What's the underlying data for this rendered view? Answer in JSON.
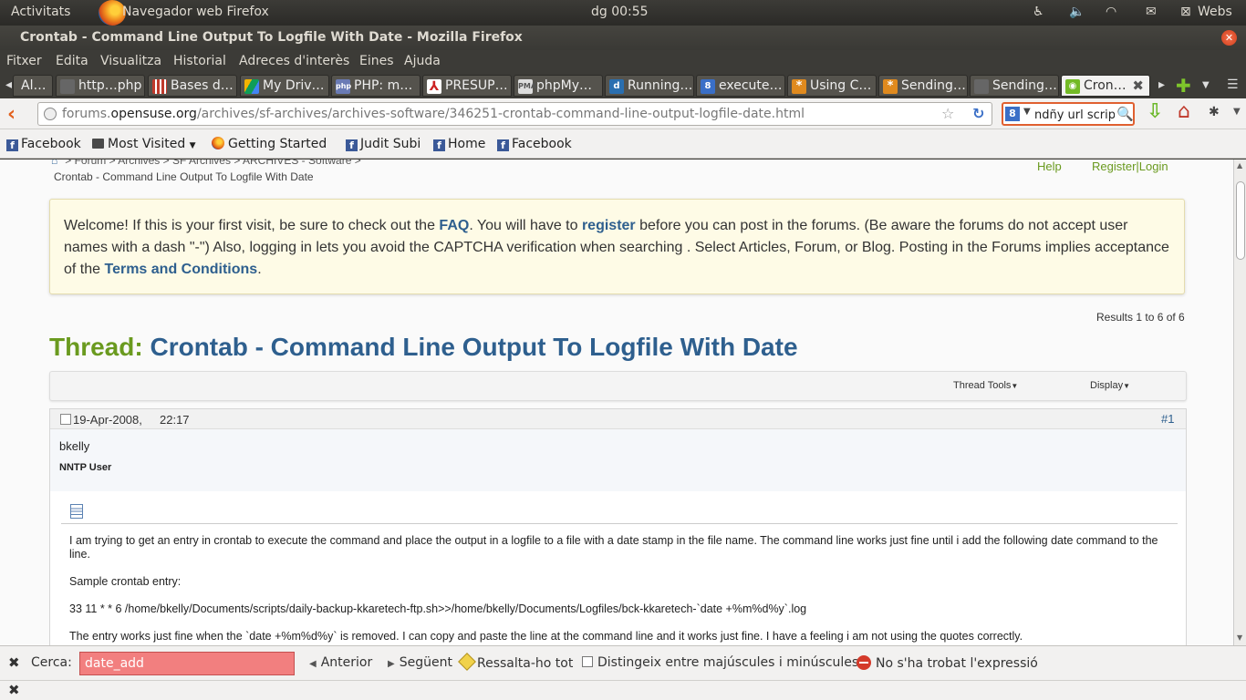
{
  "top_panel": {
    "activities": "Activitats",
    "app_name": "Navegador web Firefox",
    "clock": "dg 00:55",
    "webs": "Webs",
    "tray_icons": [
      "accessibility-icon",
      "volume-icon",
      "wifi-icon",
      "mail-icon"
    ]
  },
  "window": {
    "title": "Crontab - Command Line Output To Logfile With Date - Mozilla Firefox"
  },
  "menu": [
    "Fitxer",
    "Edita",
    "Visualitza",
    "Historial",
    "Adreces d'interès",
    "Eines",
    "Ajuda"
  ],
  "tabs": [
    {
      "label": "Al…",
      "icon": "page-icon",
      "color": "#777777"
    },
    {
      "label": "http…php",
      "icon": "page-icon",
      "color": "#666666"
    },
    {
      "label": "Bases d…",
      "icon": "stripes-icon",
      "color": "#c0392b"
    },
    {
      "label": "My Driv…",
      "icon": "drive-icon",
      "color": "#f4b400"
    },
    {
      "label": "PHP: m…",
      "icon": "php-icon",
      "color": "#6a7bb5"
    },
    {
      "label": "PRESUP…",
      "icon": "pdf-icon",
      "color": "#cc2222"
    },
    {
      "label": "phpMy…",
      "icon": "phpmyadmin-icon",
      "color": "#777777"
    },
    {
      "label": "Running…",
      "icon": "d-icon",
      "color": "#2a6fb0"
    },
    {
      "label": "execute…",
      "icon": "google-icon",
      "color": "#3a6fc7"
    },
    {
      "label": "Using C…",
      "icon": "asterisk-icon",
      "color": "#e08a1e"
    },
    {
      "label": "Sending…",
      "icon": "asterisk-icon",
      "color": "#e08a1e"
    },
    {
      "label": "Sending…",
      "icon": "page-icon",
      "color": "#666666"
    },
    {
      "label": "Cron…",
      "icon": "opensuse-icon",
      "color": "#73ba25",
      "active": true
    }
  ],
  "nav": {
    "url_prefix": "forums.",
    "url_host": "opensuse.org",
    "url_path": "/archives/sf-archives/archives-software/346251-crontab-command-line-output-logfile-date.html",
    "search_value": "ndñy url scrip"
  },
  "bookmarks": [
    "Facebook",
    "Most Visited",
    "Getting Started",
    "Judit Subi",
    "Home",
    "Facebook"
  ],
  "page": {
    "breadcrumb": "> Forum > Archives > SF Archives > ARCHIVES - Software >",
    "breadcrumb_current": "Crontab - Command Line Output To Logfile With Date",
    "help_link": "Help",
    "login_link": "Register|Login",
    "notice": {
      "t1": "Welcome! If this is your first visit, be sure to check out the ",
      "faq": "FAQ",
      "t2": ". You will have to ",
      "register": "register",
      "t3": " before you can post in the forums. (Be aware the forums do not accept user names with a dash \"-\") Also, logging in lets you avoid the CAPTCHA verification when searching . Select Articles, Forum, or Blog. Posting in the Forums implies acceptance of the ",
      "terms": "Terms and Conditions",
      "t4": "."
    },
    "results": "Results 1 to 6 of 6",
    "thread_prefix": "Thread:",
    "thread_title": "Crontab - Command Line Output To Logfile With Date",
    "thread_tools": "Thread Tools",
    "display": "Display",
    "post": {
      "date": "19-Apr-2008,",
      "time": "22:17",
      "number": "#1",
      "username": "bkelly",
      "user_title": "NNTP User",
      "paragraphs": [
        "I am trying to get an entry in crontab to execute the command and place the output in a logfile to a file with a date stamp in the file name. The command line works just fine until i add the following date command to the line.",
        "Sample crontab entry:",
        "33 11 * * 6 /home/bkelly/Documents/scripts/daily-backup-kkaretech-ftp.sh>>/home/bkelly/Documents/Logfiles/bck-kkaretech-`date +%m%d%y`.log",
        "The entry works just fine when the `date +%m%d%y` is removed. I can copy and paste the line at the command line and it works just fine. I have a feeling i am not using the quotes correctly."
      ]
    }
  },
  "find_bar": {
    "label": "Cerca:",
    "value": "date_add",
    "prev": "Anterior",
    "next": "Següent",
    "highlight": "Ressalta-ho tot",
    "match_case": "Distingeix entre majúscules i minúscules",
    "not_found": "No s'ha trobat l'expressió"
  }
}
